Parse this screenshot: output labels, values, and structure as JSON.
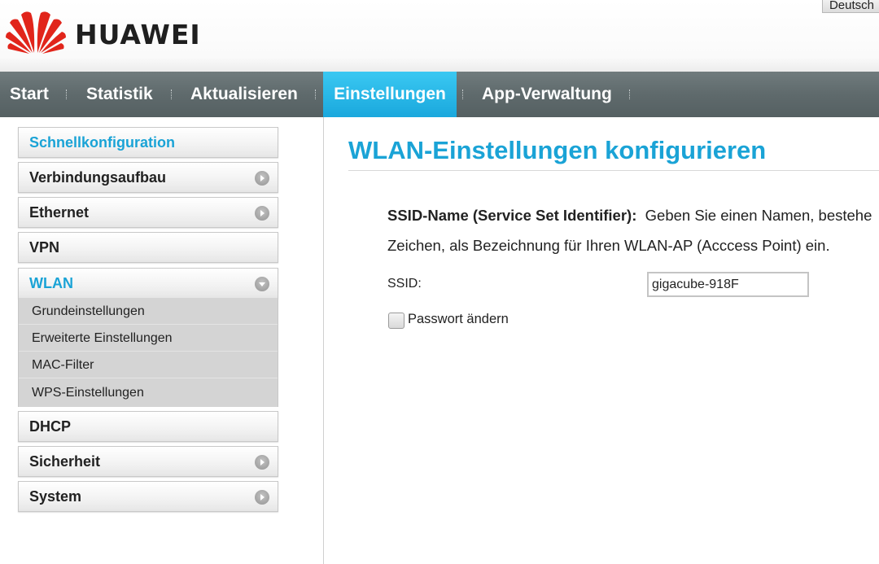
{
  "header": {
    "brand": "HUAWEI",
    "language": "Deutsch"
  },
  "nav": {
    "items": [
      {
        "label": "Start"
      },
      {
        "label": "Statistik"
      },
      {
        "label": "Aktualisieren"
      },
      {
        "label": "Einstellungen",
        "active": true
      },
      {
        "label": "App-Verwaltung"
      }
    ]
  },
  "sidebar": {
    "items": [
      {
        "label": "Schnellkonfiguration"
      },
      {
        "label": "Verbindungsaufbau"
      },
      {
        "label": "Ethernet"
      },
      {
        "label": "VPN"
      },
      {
        "label": "WLAN",
        "expanded": true
      },
      {
        "label": "DHCP"
      },
      {
        "label": "Sicherheit"
      },
      {
        "label": "System"
      }
    ],
    "wlan_submenu": [
      {
        "label": "Grundeinstellungen"
      },
      {
        "label": "Erweiterte Einstellungen"
      },
      {
        "label": "MAC-Filter"
      },
      {
        "label": "WPS-Einstellungen"
      }
    ]
  },
  "main": {
    "title": "WLAN-Einstellungen konfigurieren",
    "description_term": "SSID-Name (Service Set Identifier):",
    "description_line1": "Geben Sie einen Namen, bestehe",
    "description_line2": "Zeichen, als Bezeichnung für Ihren WLAN-AP (Acccess Point) ein.",
    "ssid_label": "SSID:",
    "ssid_value": "gigacube-918F",
    "password_checkbox_label": "Passwort ändern",
    "password_checked": false
  },
  "colors": {
    "accent": "#1aa3d6",
    "nav_bg": "#5f6a6c",
    "nav_active": "#22b2e6",
    "logo_red": "#e1251b"
  }
}
